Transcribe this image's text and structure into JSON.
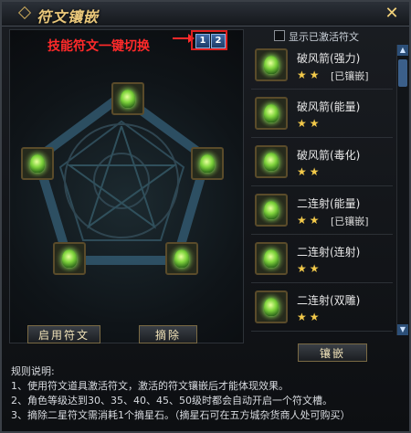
{
  "window": {
    "title": "符文镶嵌",
    "close_label": "✕"
  },
  "hint": {
    "text": "技能符文一键切换"
  },
  "pages": [
    "1",
    "2"
  ],
  "checkbox": {
    "label": "显示已激活符文"
  },
  "buttons": {
    "enable": "启用符文",
    "remove": "摘除",
    "inlay": "镶嵌"
  },
  "runes": [
    {
      "name": "破风箭(强力)",
      "stars": "★★",
      "tag": "[已镶嵌]"
    },
    {
      "name": "破风箭(能量)",
      "stars": "★★",
      "tag": ""
    },
    {
      "name": "破风箭(毒化)",
      "stars": "★★",
      "tag": ""
    },
    {
      "name": "二连射(能量)",
      "stars": "★★",
      "tag": "[已镶嵌]"
    },
    {
      "name": "二连射(连射)",
      "stars": "★★",
      "tag": ""
    },
    {
      "name": "二连射(双雕)",
      "stars": "★★",
      "tag": ""
    }
  ],
  "rules": {
    "title": "规则说明:",
    "lines": [
      "1、使用符文道具激活符文，激活的符文镶嵌后才能体现效果。",
      "2、角色等级达到30、35、40、45、50级时都会自动开启一个符文槽。",
      "3、摘除二星符文需消耗1个摘星石。（摘星石可在五方城杂货商人处可购买）"
    ]
  },
  "colors": {
    "accent": "#e9c77a",
    "hint": "#ff2a2a",
    "star": "#f2c94a"
  }
}
